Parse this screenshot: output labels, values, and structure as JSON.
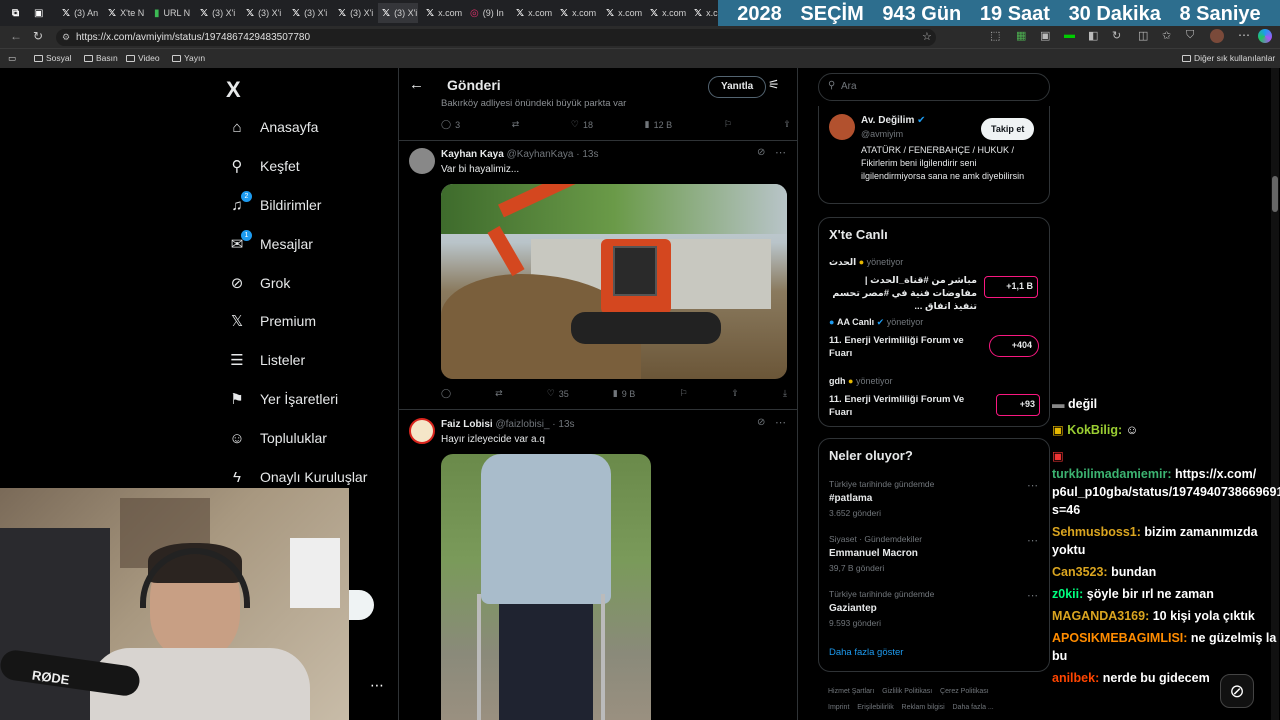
{
  "browser": {
    "tabs": [
      "(3) An",
      "X'te N",
      "URL N",
      "(3) X'i",
      "(3) X'i",
      "(3) X'i",
      "(3) X'i",
      "(3) X'i",
      "x.com",
      "(9) In",
      "x.com",
      "x.com",
      "x.com",
      "x.com",
      "x.com"
    ],
    "url": "https://x.com/avmiyim/status/1974867429483507780",
    "bookmarks": [
      "Sosyal",
      "Basın",
      "Video",
      "Yayın"
    ],
    "bookmarks_right": "Diğer sık kullanılanlar"
  },
  "countdown": {
    "year": "2028",
    "label": "SEÇİM",
    "days": "943 Gün",
    "hours": "19 Saat",
    "minutes": "30 Dakika",
    "seconds": "8 Saniye"
  },
  "nav": {
    "logo": "X",
    "items": [
      {
        "label": "Anasayfa",
        "icon": "home-icon"
      },
      {
        "label": "Keşfet",
        "icon": "search-icon"
      },
      {
        "label": "Bildirimler",
        "icon": "bell-icon",
        "badge": "2"
      },
      {
        "label": "Mesajlar",
        "icon": "mail-icon",
        "badge": "1"
      },
      {
        "label": "Grok",
        "icon": "grok-icon"
      },
      {
        "label": "Premium",
        "icon": "x-icon"
      },
      {
        "label": "Listeler",
        "icon": "list-icon"
      },
      {
        "label": "Yer İşaretleri",
        "icon": "bookmark-icon"
      },
      {
        "label": "Topluluklar",
        "icon": "people-icon"
      },
      {
        "label": "Onaylı Kuruluşlar",
        "icon": "lightning-icon"
      }
    ]
  },
  "header": {
    "title": "Gönderi",
    "reply_button": "Yanıtla"
  },
  "tweets": [
    {
      "text": "Bakırköy adliyesi önündeki büyük parkta var",
      "replies": "3",
      "retweets": "",
      "likes": "18",
      "views": "12 B"
    },
    {
      "name": "Kayhan Kaya",
      "handle": "@KayhanKaya · 13s",
      "text": "Var bi hayalimiz...",
      "replies": "",
      "retweets": "",
      "likes": "35",
      "views": "9 B"
    },
    {
      "name": "Faiz Lobisi",
      "handle": "@faizlobisi_ · 13s",
      "text": "Hayır izleyecide var a.q"
    }
  ],
  "search": {
    "placeholder": "Ara"
  },
  "profile": {
    "name": "Av. Değilim",
    "handle": "@avmiyim",
    "follow": "Takip et",
    "bio": "ATATÜRK / FENERBAHÇE / HUKUK / Fikirlerim beni ilgilendirir seni ilgilendirmiyorsa sana ne amk diyebilirsin"
  },
  "live": {
    "title": "X'te Canlı",
    "items": [
      {
        "host": "الحدث",
        "status": "yönetiyor",
        "text": "مباشر من #قناة_الحدث | مفاوضات فنية في #مصر تحسم تنفيذ اتفاق ...",
        "count": "+1,1 B"
      },
      {
        "host": "AA Canlı",
        "status": "yönetiyor",
        "text": "11. Enerji Verimliliği Forum ve Fuarı",
        "count": "+404"
      },
      {
        "host": "gdh",
        "status": "yönetiyor",
        "text": "11. Enerji Verimliliği Forum Ve Fuarı",
        "count": "+93"
      }
    ]
  },
  "trends": {
    "title": "Neler oluyor?",
    "items": [
      {
        "meta": "Türkiye tarihinde gündemde",
        "name": "#patlama",
        "count": "3.652 gönderi"
      },
      {
        "meta": "Siyaset · Gündemdekiler",
        "name": "Emmanuel Macron",
        "count": "39,7 B gönderi"
      },
      {
        "meta": "Türkiye tarihinde gündemde",
        "name": "Gaziantep",
        "count": "9.593 gönderi"
      }
    ],
    "more": "Daha fazla göster"
  },
  "footer": [
    "Hizmet Şartları",
    "Gizlilik Politikası",
    "Çerez Politikası",
    "Imprint",
    "Erişilebilirlik",
    "Reklam bilgisi",
    "Daha fazla ..."
  ],
  "chat": [
    {
      "user": "",
      "msg": "değil",
      "color": "#ffffff"
    },
    {
      "user": "KokBilig:",
      "msg": "",
      "color": "#9acd32"
    },
    {
      "user": "turkbilimadamiemir:",
      "msg": "https://x.com/ p6ul_p10gba/status/1974940738669691226?s=46",
      "color": "#3cb371"
    },
    {
      "user": "Sehmusboss1:",
      "msg": "bizim zamanımızda yoktu",
      "color": "#daa520"
    },
    {
      "user": "Can3523:",
      "msg": "bundan",
      "color": "#daa520"
    },
    {
      "user": "z0kii:",
      "msg": "şöyle bir ırl ne zaman",
      "color": "#00ff7f"
    },
    {
      "user": "MAGANDA3169:",
      "msg": "10 kişi yola çıktık",
      "color": "#daa520"
    },
    {
      "user": "APOSIKMEBAGIMLISI:",
      "msg": "ne güzelmiş la bu",
      "color": "#ff8c00"
    },
    {
      "user": "anilbek:",
      "msg": "nerde bu gidecem",
      "color": "#ff4500"
    }
  ],
  "webcam": {
    "mic_brand": "RØDE"
  }
}
